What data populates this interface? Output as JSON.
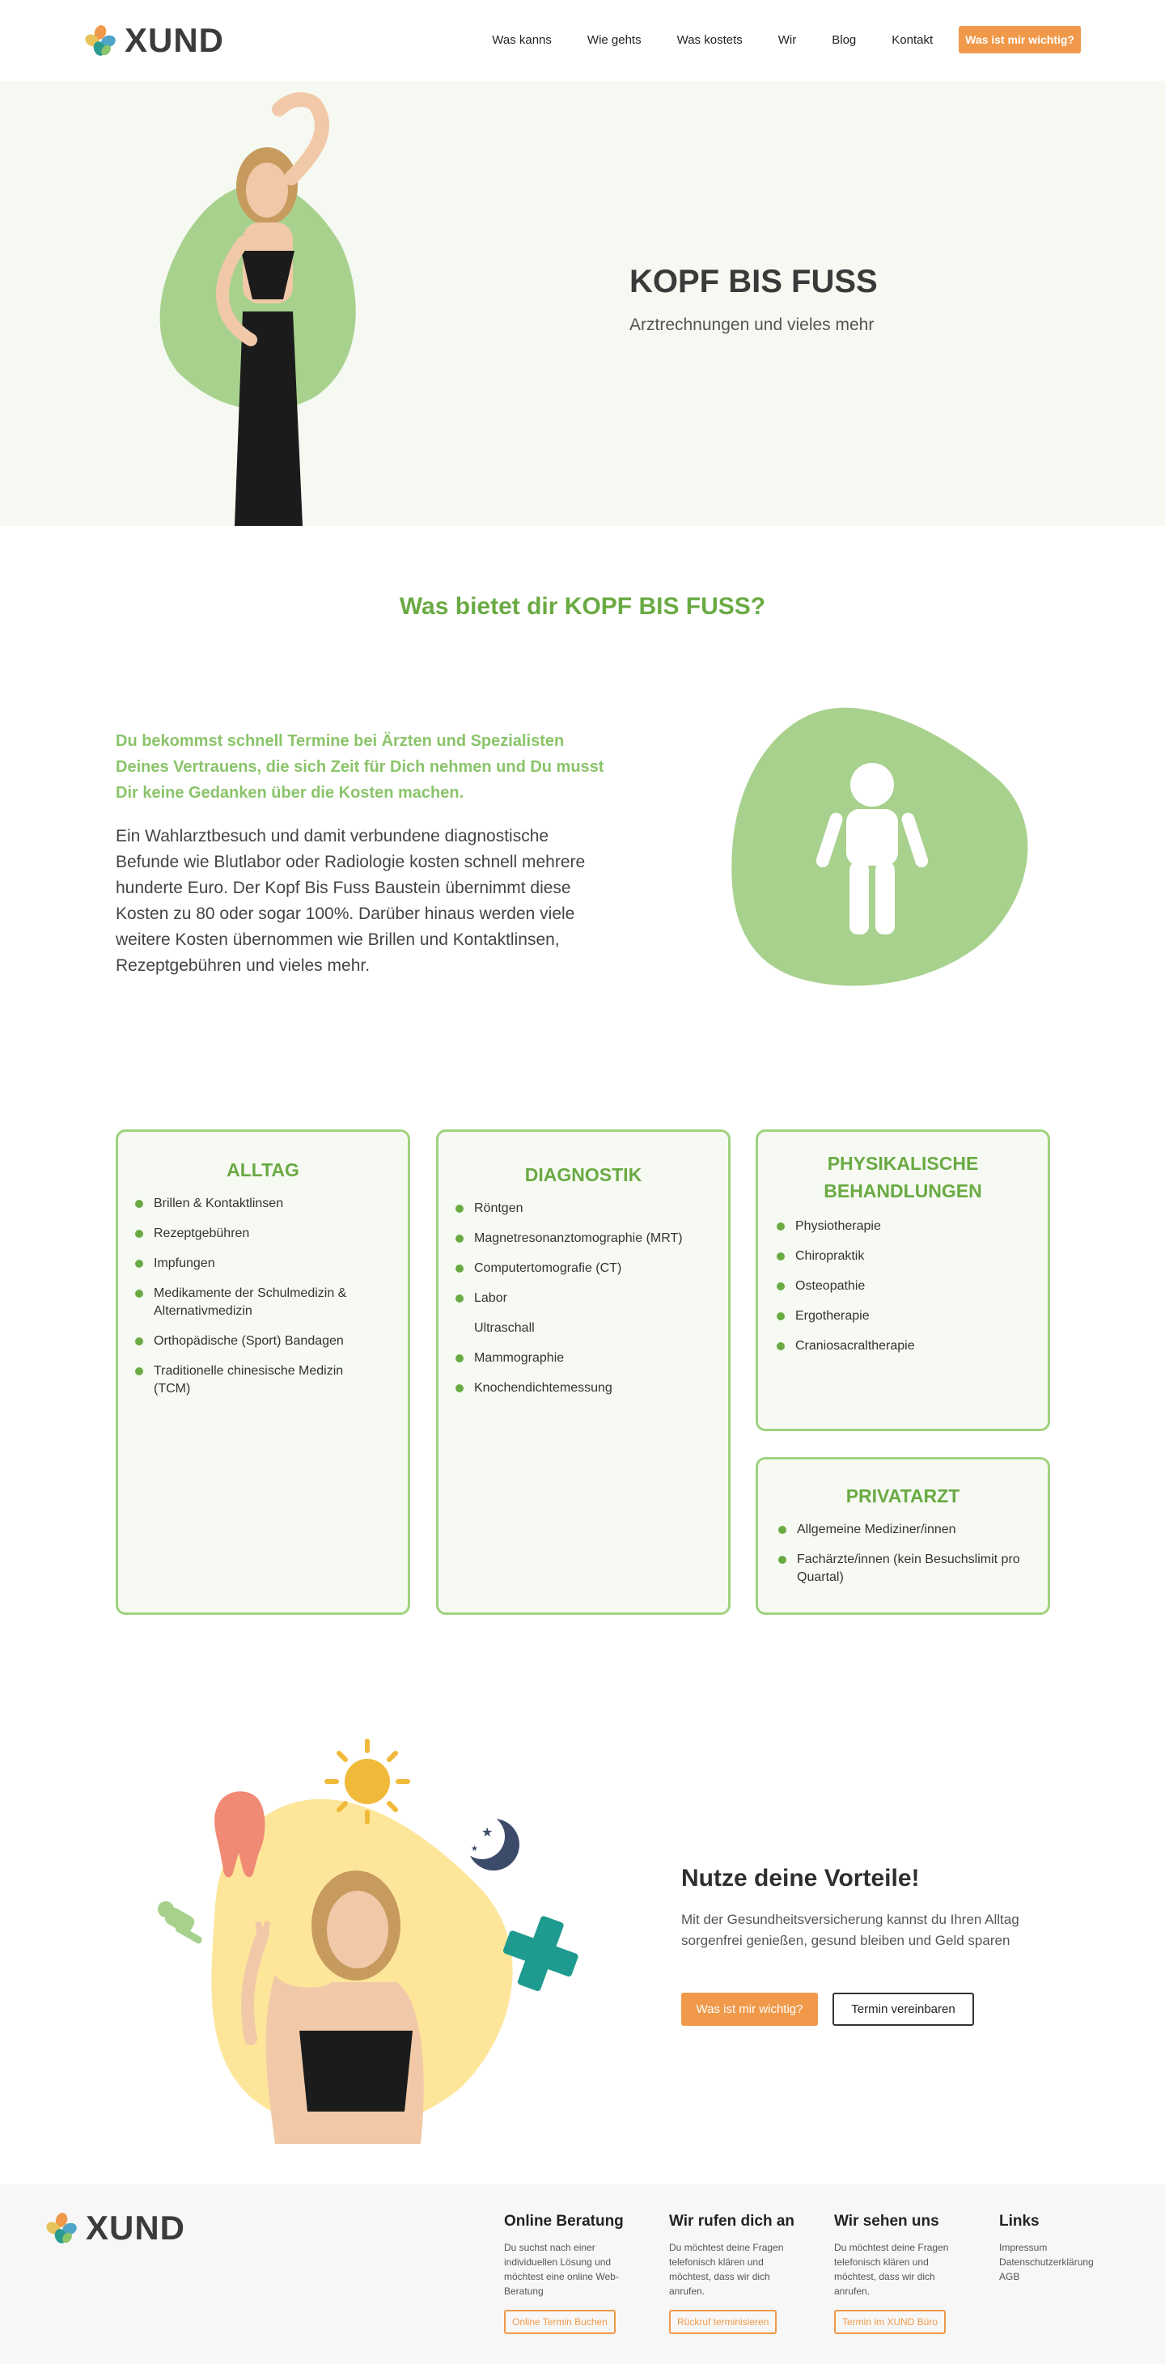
{
  "header": {
    "logo_text": "XUND",
    "nav": [
      "Was kanns",
      "Wie gehts",
      "Was kostets",
      "Wir",
      "Blog",
      "Kontakt"
    ],
    "cta": "Was ist mir wichtig?"
  },
  "hero": {
    "title": "KOPF BIS FUSS",
    "subtitle": "Arztrechnungen und vieles mehr"
  },
  "offer": {
    "title": "Was bietet dir KOPF BIS FUSS?",
    "highlight": "Du bekommst schnell Termine bei Ärzten und Spezialisten Deines  Vertrauens, die sich Zeit für Dich nehmen und Du musst Dir keine  Gedanken über die Kosten machen.",
    "body": "Ein Wahlarztbesuch und damit verbundene diagnostische Befunde wie Blutlabor  oder Radiologie kosten schnell mehrere hunderte Euro. Der Kopf Bis Fuss Baustein  übernimmt diese Kosten zu 80 oder sogar 100%. Darüber hinaus werden viele  weitere Kosten übernommen wie Brillen und Kontaktlinsen, Rezeptgebühren  und vieles mehr."
  },
  "cards": {
    "alltag": {
      "title": "ALLTAG",
      "items": [
        "Brillen & Kontaktlinsen",
        "Rezeptgebühren",
        "Impfungen",
        "Medikamente der Schulmedizin & Alternativmedizin",
        "Orthopädische (Sport) Bandagen",
        "Traditionelle chinesische Medizin (TCM)"
      ]
    },
    "diagnostik": {
      "title": "DIAGNOSTIK",
      "items": [
        " Röntgen",
        "Magnetresonanztomographie (MRT)",
        "Computertomografie (CT)",
        "Labor",
        "Ultraschall",
        "Mammographie",
        "Knochendichtemessung"
      ]
    },
    "physikalisch": {
      "title": "PHYSIKALISCHE BEHANDLUNGEN",
      "items": [
        "Physiotherapie",
        "Chiropraktik",
        "Osteopathie",
        "Ergotherapie",
        "Craniosacraltherapie"
      ]
    },
    "privatarzt": {
      "title": "PRIVATARZT",
      "items": [
        "Allgemeine Mediziner/innen",
        "Fachärzte/innen (kein Besuchslimit pro Quartal)"
      ]
    }
  },
  "benefits": {
    "title": "Nutze deine Vorteile!",
    "text": "Mit der Gesundheitsversicherung kannst du Ihren Alltag sorgenfrei genießen, gesund bleiben und Geld sparen",
    "btn_primary": "Was ist mir wichtig?",
    "btn_secondary": "Termin vereinbaren"
  },
  "footer": {
    "logo_text": "XUND",
    "online": {
      "title": "Online Beratung",
      "text": "Du suchst nach einer individuellen Lösung und möchtest eine online Web-Beratung",
      "button": "Online Termin Buchen"
    },
    "call": {
      "title": "Wir rufen dich an",
      "text": "Du möchtest deine Fragen telefonisch klären und möchtest, dass wir dich anrufen.",
      "button": "Rückruf terminisieren"
    },
    "meet": {
      "title": "Wir sehen uns",
      "text": "Du möchtest deine Fragen telefonisch klären und möchtest, dass wir dich anrufen.",
      "button": "Termin im XUND Büro"
    },
    "links": {
      "title": "Links",
      "items": [
        "Impressum",
        "Datenschutzerklärung",
        "AGB"
      ]
    }
  },
  "colors": {
    "brand_green": "#6aaa43",
    "light_green": "#a8d18d",
    "orange": "#f0994a",
    "hero_bg": "#f5f9f2",
    "yellow_blob": "#fde69a"
  }
}
